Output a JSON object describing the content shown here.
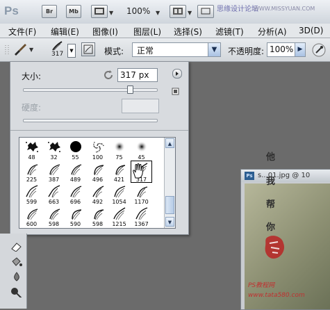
{
  "app": {
    "logo": "Ps",
    "bridge_label": "Br",
    "minibridge_label": "Mb",
    "zoom": "100%",
    "site_watermark": "思缘设计论坛",
    "site_url": "WWW.MISSYUAN.COM"
  },
  "menu": {
    "items": [
      "文件(F)",
      "编辑(E)",
      "图像(I)",
      "图层(L)",
      "选择(S)",
      "滤镜(T)",
      "分析(A)",
      "3D(D)"
    ]
  },
  "options": {
    "brush_size": "317",
    "mode_label": "模式:",
    "mode_value": "正常",
    "opacity_label": "不透明度:",
    "opacity_value": "100%"
  },
  "brush_panel": {
    "size_label": "大小:",
    "size_value": "317 px",
    "size_fraction": 0.8,
    "hardness_label": "硬度:",
    "hardness_value": "",
    "hardness_fraction": 1.0,
    "presets": [
      {
        "size": "48",
        "shape": "splat"
      },
      {
        "size": "32",
        "shape": "splat"
      },
      {
        "size": "55",
        "shape": "disc"
      },
      {
        "size": "100",
        "shape": "speckle"
      },
      {
        "size": "75",
        "shape": "soft"
      },
      {
        "size": "45",
        "shape": "soft"
      },
      {
        "size": "225",
        "shape": "hair"
      },
      {
        "size": "387",
        "shape": "hair"
      },
      {
        "size": "489",
        "shape": "hair"
      },
      {
        "size": "496",
        "shape": "hair"
      },
      {
        "size": "421",
        "shape": "hair"
      },
      {
        "size": "317",
        "shape": "hair",
        "selected": true
      },
      {
        "size": "599",
        "shape": "hair"
      },
      {
        "size": "663",
        "shape": "hair"
      },
      {
        "size": "696",
        "shape": "hair"
      },
      {
        "size": "492",
        "shape": "hair"
      },
      {
        "size": "1054",
        "shape": "hair"
      },
      {
        "size": "1170",
        "shape": "hair"
      },
      {
        "size": "600",
        "shape": "hair"
      },
      {
        "size": "598",
        "shape": "hair"
      },
      {
        "size": "590",
        "shape": "hair"
      },
      {
        "size": "598",
        "shape": "hair"
      },
      {
        "size": "1215",
        "shape": "hair"
      },
      {
        "size": "1367",
        "shape": "hair"
      }
    ],
    "scroll_fraction": 0.85
  },
  "document": {
    "icon_label": "Ps",
    "title": "s...01.jpg @ 10"
  },
  "watermark": {
    "chars": [
      "他",
      "我",
      "帮",
      "你"
    ],
    "footer": "PS教程网 www.tata580.com"
  },
  "colors": {
    "accent_blue": "#2c5e91",
    "canvas_gray": "#6b6b6b",
    "panel_bg": "#d8dbdf"
  }
}
